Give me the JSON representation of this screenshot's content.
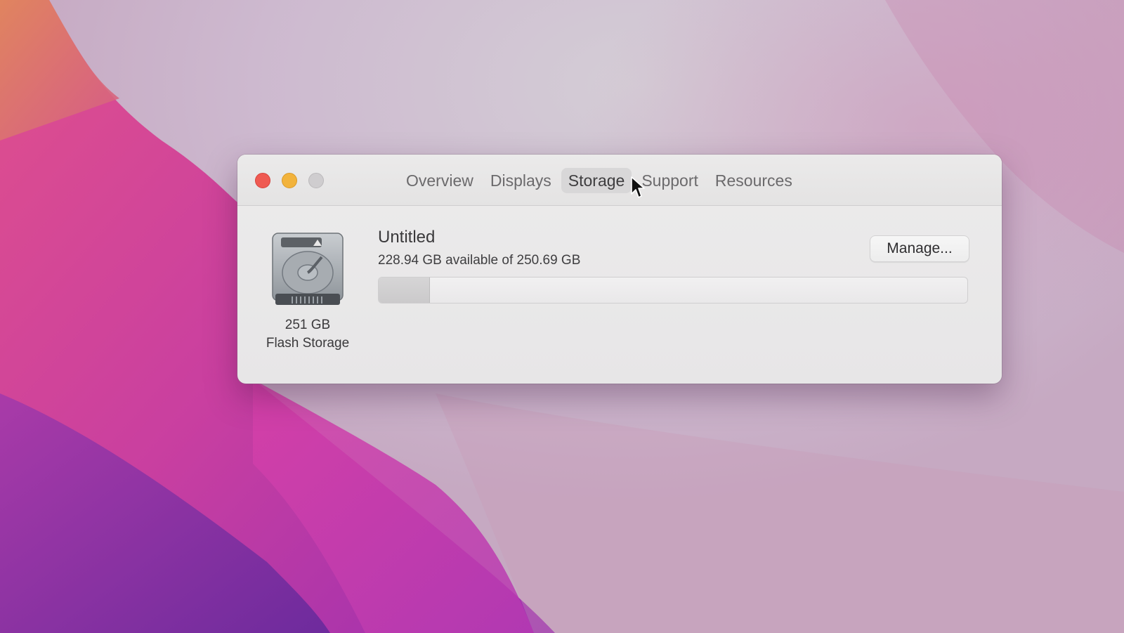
{
  "window": {
    "tabs": [
      {
        "label": "Overview",
        "selected": false
      },
      {
        "label": "Displays",
        "selected": false
      },
      {
        "label": "Storage",
        "selected": true
      },
      {
        "label": "Support",
        "selected": false
      },
      {
        "label": "Resources",
        "selected": false
      }
    ],
    "traffic_lights": {
      "close_color": "#ef5a52",
      "minimize_color": "#f2b33c",
      "zoom_color": "#cfcdcf"
    }
  },
  "storage": {
    "disk_icon": "hard-drive-icon",
    "disk_size": "251 GB",
    "disk_type": "Flash Storage",
    "volume_name": "Untitled",
    "summary": "228.94 GB available of 250.69 GB",
    "used_fraction": 0.087,
    "manage_label": "Manage..."
  },
  "cursor": {
    "icon": "pointer-arrow-icon"
  }
}
